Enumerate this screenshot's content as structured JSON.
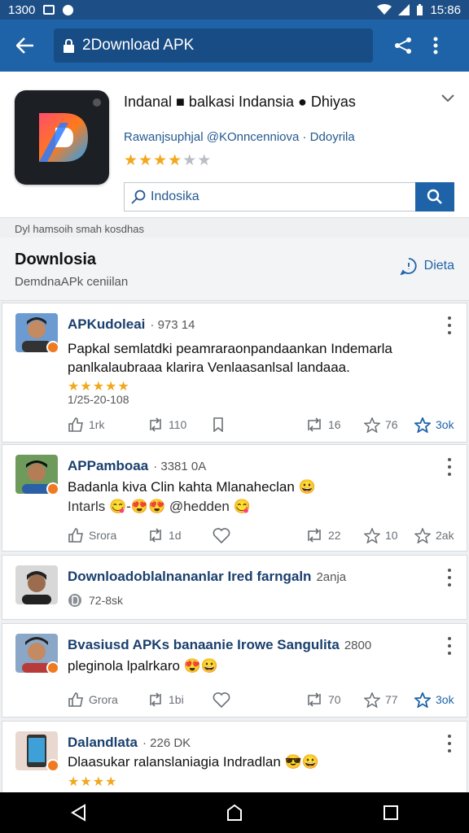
{
  "status_bar": {
    "time_left": "1300",
    "time_right": "15:86"
  },
  "app_bar": {
    "title": "2Download APK"
  },
  "app": {
    "title": "Indanal ■ balkasi Indansia ● Dhiyas",
    "subtitle": "Rawanjsuphjal @KOnncenniova · Ddoyrila",
    "rating": 3.5,
    "search_value": "Indosika"
  },
  "notice": "Dyl hamsoih smah kosdhas",
  "section": {
    "title": "Downlosia",
    "subtitle": "DemdnaAPk ceniilan",
    "action": "Dieta"
  },
  "posts": [
    {
      "author": "APKudoleai",
      "meta": "· 973 14",
      "text": "Papkal semlatdki peamraraonpandaankan Indemarla panlkalaubraaa klarira Venlaasanlsal landaaa.",
      "stars": 5,
      "date": "1/25-20-108",
      "actions": [
        "1rk",
        "110",
        "",
        "16",
        "76",
        "3ok"
      ]
    },
    {
      "author": "APPamboaa",
      "meta": "· 3381 0A",
      "text": "Badanla kiva Clin kahta Mlanaheclan 😀",
      "text2": "Intarls 😋-😍😍 @hedden 😋",
      "actions": [
        "Srora",
        "1d",
        "",
        "22",
        "10",
        "2ak"
      ]
    },
    {
      "author": "Downloadoblalnananlar Ired farngaln",
      "meta": "2anja",
      "sub": "72-8sk"
    },
    {
      "author": "Bvasiusd APKs banaanie Irowe Sangulita",
      "meta": "2800",
      "text": "pleginola lpalrkaro 😍😀",
      "actions": [
        "Grora",
        "1bi",
        "",
        "70",
        "77",
        "3ok"
      ]
    },
    {
      "author": "Dalandlata",
      "meta": "· 226 DK",
      "text": "Dlaasukar ralanslaniagia Indradlan 😎😀",
      "stars": 4
    }
  ],
  "colors": {
    "appbar": "#1e63a8",
    "status": "#1d4f86",
    "star": "#f1a81c",
    "accent": "#1e63a8"
  }
}
